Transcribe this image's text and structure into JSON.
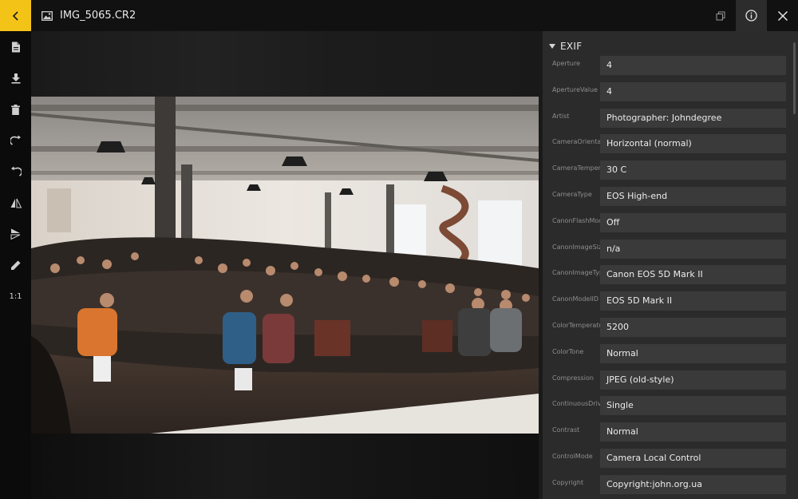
{
  "topbar": {
    "title": "IMG_5065.CR2",
    "icons": {
      "back": "chevron-left-icon",
      "image": "image-icon",
      "restore": "restore-window-icon",
      "info": "info-icon",
      "close": "close-icon"
    }
  },
  "toolbar": {
    "items": [
      {
        "icon": "file-icon"
      },
      {
        "icon": "download-icon"
      },
      {
        "icon": "trash-icon"
      },
      {
        "icon": "rotate-right-icon"
      },
      {
        "icon": "rotate-left-icon"
      },
      {
        "icon": "flip-horizontal-icon"
      },
      {
        "icon": "flip-vertical-icon"
      },
      {
        "icon": "pencil-icon"
      },
      {
        "label": "1:1"
      }
    ]
  },
  "panel": {
    "section_title": "EXIF",
    "rows": [
      {
        "label": "Aperture",
        "value": "4"
      },
      {
        "label": "ApertureValue",
        "value": "4"
      },
      {
        "label": "Artist",
        "value": "Photographer: Johndegree"
      },
      {
        "label": "CameraOrientation",
        "value": "Horizontal (normal)"
      },
      {
        "label": "CameraTemperature",
        "value": "30 C"
      },
      {
        "label": "CameraType",
        "value": "EOS High-end"
      },
      {
        "label": "CanonFlashMode",
        "value": "Off"
      },
      {
        "label": "CanonImageSize",
        "value": "n/a"
      },
      {
        "label": "CanonImageType",
        "value": "Canon EOS 5D Mark II"
      },
      {
        "label": "CanonModelID",
        "value": "EOS 5D Mark II"
      },
      {
        "label": "ColorTemperature",
        "value": "5200"
      },
      {
        "label": "ColorTone",
        "value": "Normal"
      },
      {
        "label": "Compression",
        "value": "JPEG (old-style)"
      },
      {
        "label": "ContinuousDrive",
        "value": "Single"
      },
      {
        "label": "Contrast",
        "value": "Normal"
      },
      {
        "label": "ControlMode",
        "value": "Camera Local Control"
      },
      {
        "label": "Copyright",
        "value": "Copyright:john.org.ua"
      }
    ]
  },
  "colors": {
    "accent": "#f3c318",
    "panel_bg": "#2b2b2b",
    "value_bg": "#3a3a3a"
  }
}
